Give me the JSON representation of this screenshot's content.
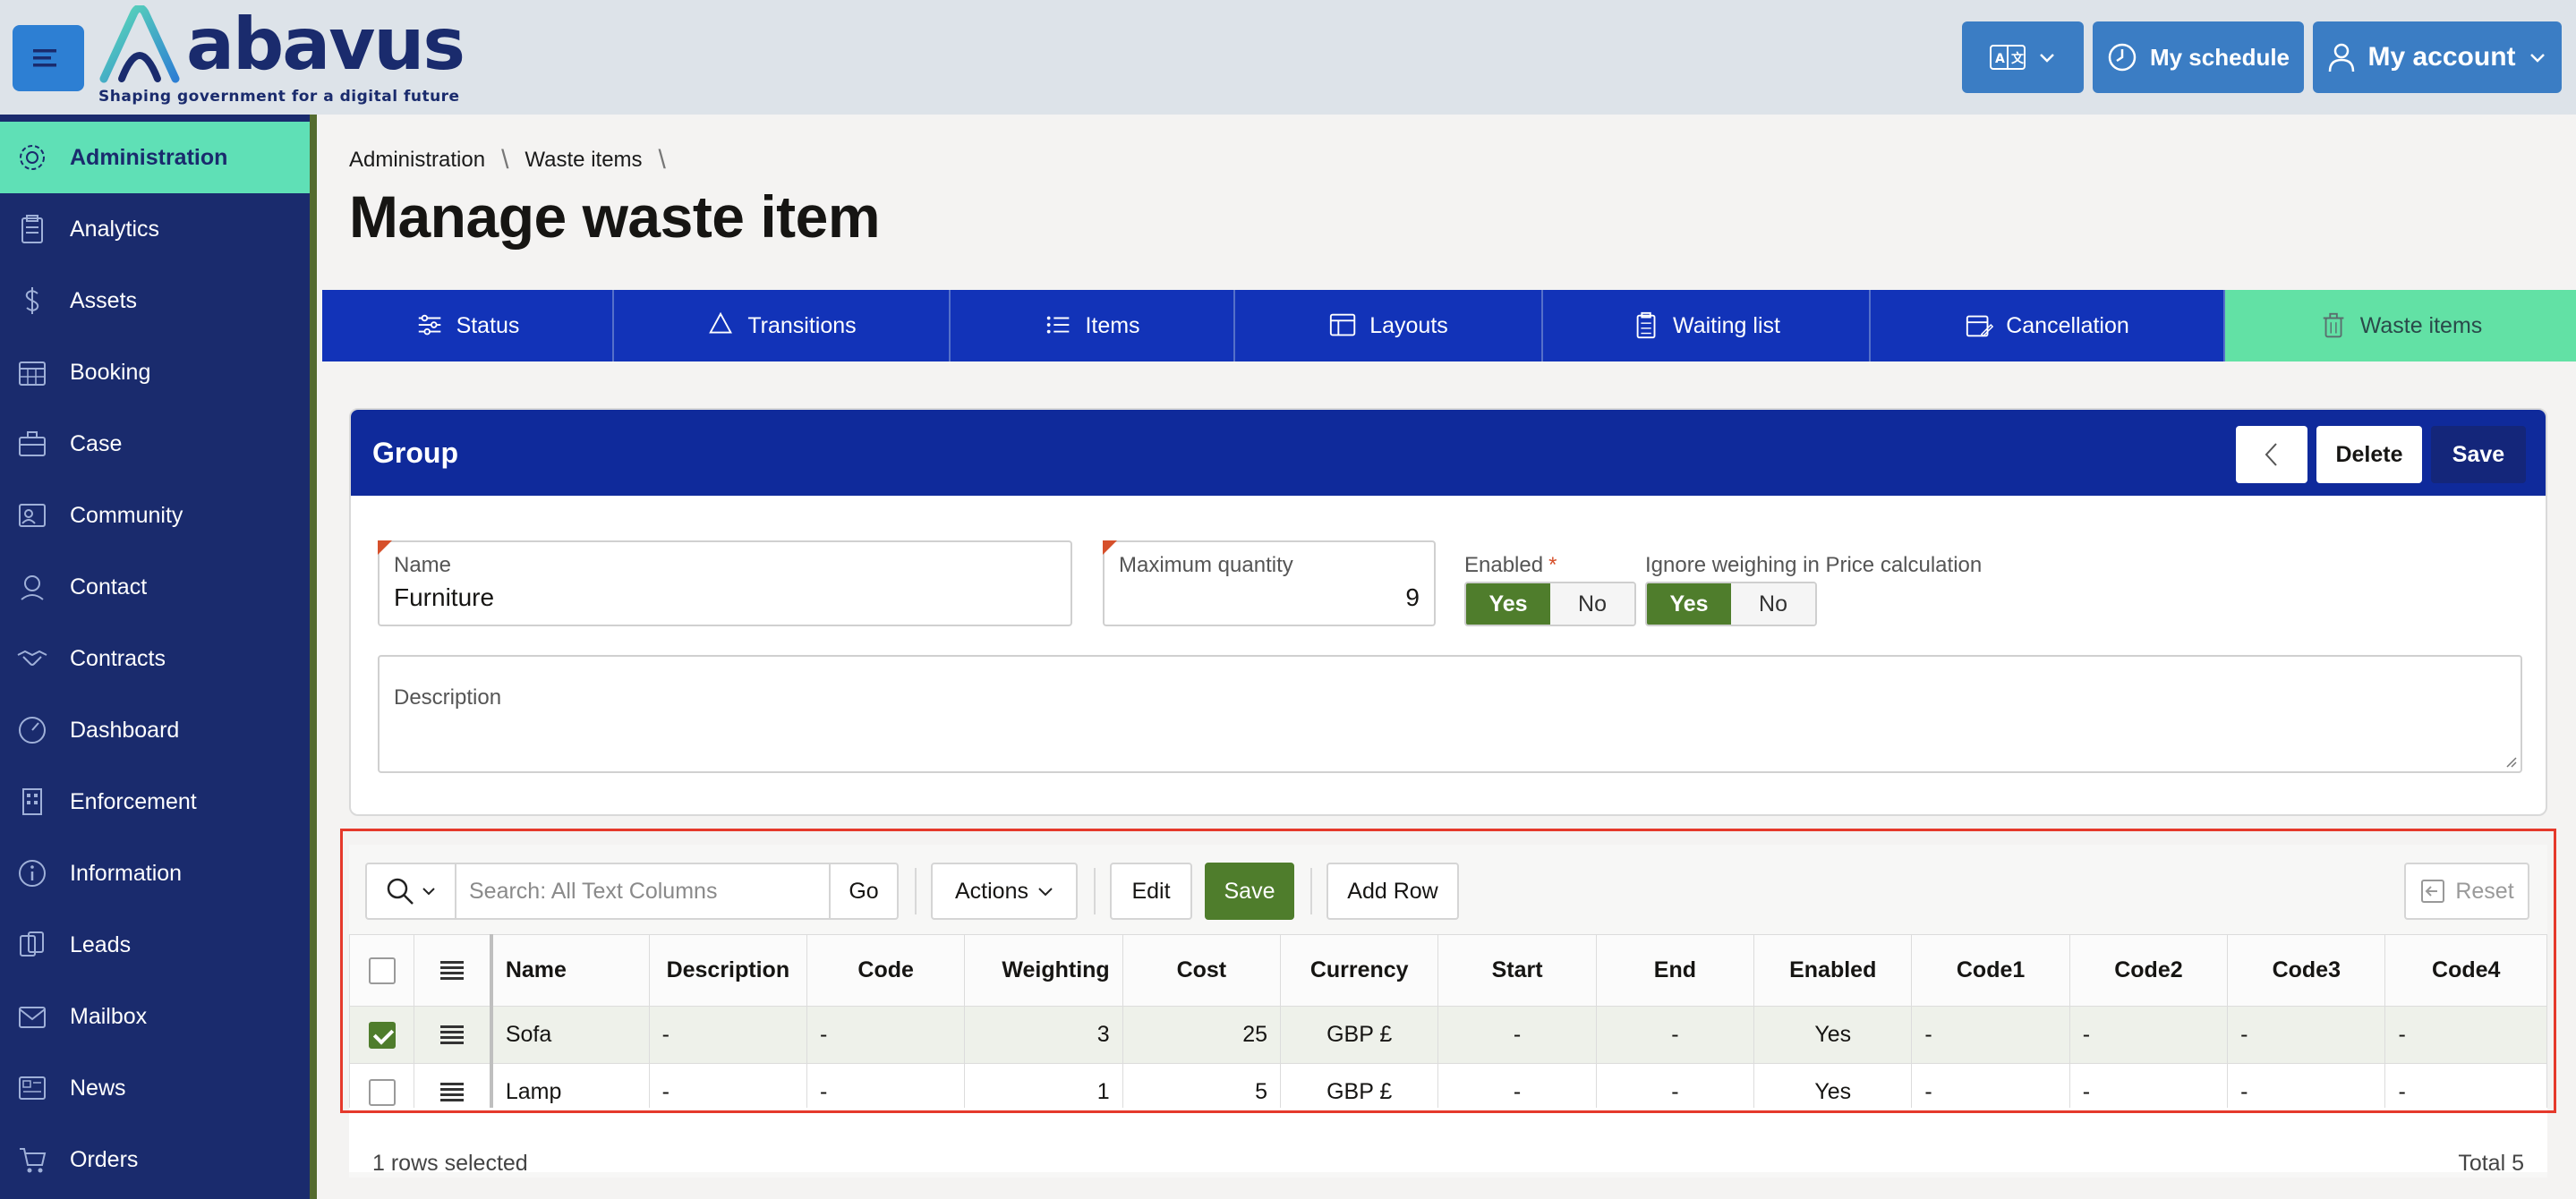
{
  "header": {
    "logo_text": "abavus",
    "logo_tagline": "Shaping government for a digital future",
    "language_button_icon": "translate-icon",
    "schedule_label": "My schedule",
    "account_label": "My account"
  },
  "sidebar": {
    "items": [
      {
        "label": "Administration",
        "icon": "gear-icon",
        "active": true
      },
      {
        "label": "Analytics",
        "icon": "clipboard-icon"
      },
      {
        "label": "Assets",
        "icon": "dollar-icon"
      },
      {
        "label": "Booking",
        "icon": "calendar-icon"
      },
      {
        "label": "Case",
        "icon": "briefcase-icon"
      },
      {
        "label": "Community",
        "icon": "community-icon"
      },
      {
        "label": "Contact",
        "icon": "contact-icon"
      },
      {
        "label": "Contracts",
        "icon": "handshake-icon"
      },
      {
        "label": "Dashboard",
        "icon": "gauge-icon"
      },
      {
        "label": "Enforcement",
        "icon": "building-icon"
      },
      {
        "label": "Information",
        "icon": "info-icon"
      },
      {
        "label": "Leads",
        "icon": "leads-icon"
      },
      {
        "label": "Mailbox",
        "icon": "mail-icon"
      },
      {
        "label": "News",
        "icon": "news-icon"
      },
      {
        "label": "Orders",
        "icon": "orders-icon"
      }
    ]
  },
  "breadcrumb": [
    "Administration",
    "Waste items"
  ],
  "page_title": "Manage waste item",
  "tabs": [
    {
      "label": "Status",
      "icon": "sliders-icon"
    },
    {
      "label": "Transitions",
      "icon": "recycle-icon"
    },
    {
      "label": "Items",
      "icon": "list-icon"
    },
    {
      "label": "Layouts",
      "icon": "layout-icon"
    },
    {
      "label": "Waiting list",
      "icon": "clipboard-list-icon"
    },
    {
      "label": "Cancellation",
      "icon": "calendar-edit-icon"
    },
    {
      "label": "Waste items",
      "icon": "trash-icon",
      "active": true
    }
  ],
  "group": {
    "title": "Group",
    "delete_label": "Delete",
    "save_label": "Save",
    "name_label": "Name",
    "name_value": "Furniture",
    "max_qty_label": "Maximum quantity",
    "max_qty_value": "9",
    "enabled_label": "Enabled",
    "enabled_required": "*",
    "ignore_label": "Ignore weighing in Price calculation",
    "yes_label": "Yes",
    "no_label": "No",
    "enabled_value": "Yes",
    "ignore_value": "Yes",
    "description_label": "Description",
    "description_value": ""
  },
  "grid": {
    "search_placeholder": "Search: All Text Columns",
    "go_label": "Go",
    "actions_label": "Actions",
    "edit_label": "Edit",
    "save_label": "Save",
    "add_row_label": "Add Row",
    "reset_label": "Reset",
    "columns": [
      "Name",
      "Description",
      "Code",
      "Weighting",
      "Cost",
      "Currency",
      "Start",
      "End",
      "Enabled",
      "Code1",
      "Code2",
      "Code3",
      "Code4"
    ],
    "rows": [
      {
        "selected": true,
        "cells": [
          "Sofa",
          "-",
          "-",
          "3",
          "25",
          "GBP £",
          "-",
          "-",
          "Yes",
          "-",
          "-",
          "-",
          "-"
        ]
      },
      {
        "selected": false,
        "cells": [
          "Lamp",
          "-",
          "-",
          "1",
          "5",
          "GBP £",
          "-",
          "-",
          "Yes",
          "-",
          "-",
          "-",
          "-"
        ]
      }
    ],
    "selection_status": "1 rows selected",
    "total_label": "Total 5"
  },
  "colors": {
    "header_bg": "#dde3e9",
    "sidebar_bg": "#1a2b6d",
    "sidebar_active": "#5fe0b6",
    "tab_bg": "#1233b8",
    "tab_active": "#62e1a5",
    "card_header": "#0f2a9b",
    "toggle_yes": "#4f7d2c",
    "highlight_outline": "#e5392b"
  }
}
